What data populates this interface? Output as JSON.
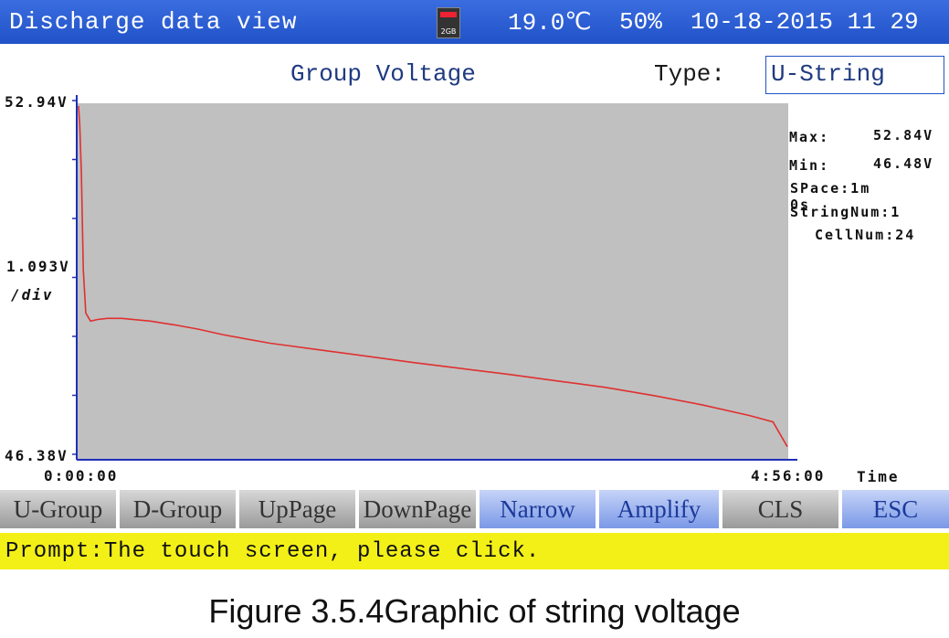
{
  "titlebar": {
    "title": "Discharge data view",
    "sd_icon": "sd-card-icon",
    "sd_label": "2GB",
    "temperature": "19.0℃",
    "humidity": "50%",
    "datetime": "10-18-2015 11 29"
  },
  "header": {
    "chart_title": "Group Voltage",
    "type_label": "Type:",
    "type_value": "U-String"
  },
  "stats": {
    "max_label": "Max:",
    "max_value": "52.84V",
    "min_label": "Min:",
    "min_value": "46.48V",
    "space": "SPace:1m 0s",
    "string_num": "StringNum:1",
    "cell_num": "CellNum:24"
  },
  "chart_data": {
    "type": "line",
    "y_top_label": "52.94V",
    "y_div_label": "1.093V",
    "y_div_unit": "/div",
    "y_bottom_label": "46.38V",
    "x_start_label": "0:00:00",
    "x_end_label": "4:56:00",
    "x_axis_label": "Time",
    "ylim": [
      46.38,
      52.94
    ],
    "xlim_minutes": [
      0,
      296
    ],
    "series": [
      {
        "color": "#e03030",
        "x": [
          0,
          0.5,
          1.2,
          2,
          3,
          5,
          8,
          12,
          18,
          25,
          30,
          40,
          50,
          60,
          70,
          80,
          90,
          100,
          120,
          140,
          160,
          180,
          200,
          220,
          240,
          260,
          280,
          290,
          296
        ],
        "y": [
          52.84,
          52.5,
          51.6,
          49.8,
          49.0,
          48.85,
          48.88,
          48.9,
          48.9,
          48.87,
          48.85,
          48.78,
          48.7,
          48.6,
          48.52,
          48.44,
          48.38,
          48.32,
          48.2,
          48.08,
          47.97,
          47.86,
          47.74,
          47.62,
          47.47,
          47.3,
          47.1,
          46.98,
          46.52
        ]
      }
    ]
  },
  "buttons": [
    {
      "label": "U-Group",
      "style": "gray"
    },
    {
      "label": "D-Group",
      "style": "gray"
    },
    {
      "label": "UpPage",
      "style": "gray"
    },
    {
      "label": "DownPage",
      "style": "gray"
    },
    {
      "label": "Narrow",
      "style": "blue"
    },
    {
      "label": "Amplify",
      "style": "blue"
    },
    {
      "label": "CLS",
      "style": "gray"
    },
    {
      "label": "ESC",
      "style": "blue"
    }
  ],
  "prompt": "Prompt:The touch screen, please click.",
  "caption": "Figure 3.5.4Graphic of string voltage"
}
